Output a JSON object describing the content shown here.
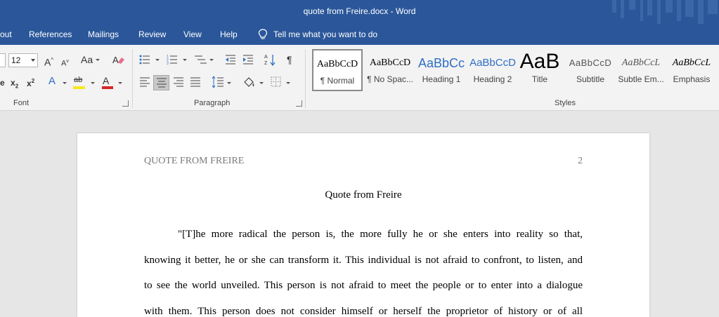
{
  "window": {
    "title": "quote from Freire.docx  -  Word"
  },
  "menu": {
    "items": [
      "out",
      "References",
      "Mailings",
      "Review",
      "View",
      "Help"
    ],
    "tell_me": "Tell me what you want to do"
  },
  "ribbon": {
    "font_size": "12",
    "groups": {
      "font": "Font",
      "paragraph": "Paragraph",
      "styles": "Styles"
    },
    "font_buttons": {
      "grow": "A",
      "shrink": "A",
      "change_case": "Aa",
      "subscript": "x",
      "superscript": "x",
      "text_effects": "A",
      "highlight": "ab",
      "font_color": "A"
    },
    "styles": [
      {
        "sample": "AaBbCcD",
        "name": "¶ Normal"
      },
      {
        "sample": "AaBbCcD",
        "name": "¶ No Spac..."
      },
      {
        "sample": "AaBbCc",
        "name": "Heading 1"
      },
      {
        "sample": "AaBbCcD",
        "name": "Heading 2"
      },
      {
        "sample": "AaB",
        "name": "Title"
      },
      {
        "sample": "AaBbCcD",
        "name": "Subtitle"
      },
      {
        "sample": "AaBbCcL",
        "name": "Subtle Em..."
      },
      {
        "sample": "AaBbCcL",
        "name": "Emphasis"
      }
    ],
    "colors": {
      "highlight": "#f7e81f",
      "font_color": "#d62728"
    }
  },
  "document": {
    "running_head": "QUOTE FROM FREIRE",
    "page_number": "2",
    "title": "Quote from Freire",
    "lines": [
      "\"[T]he more radical the person is, the more fully he or she enters into reality so that,",
      "knowing it better, he or she can transform it. This individual is not afraid to confront, to listen, and",
      "to see the world unveiled. This person is not afraid to meet the people or to enter into a dialogue",
      "with them. This person does not consider himself or herself the proprietor of history or of all"
    ]
  }
}
